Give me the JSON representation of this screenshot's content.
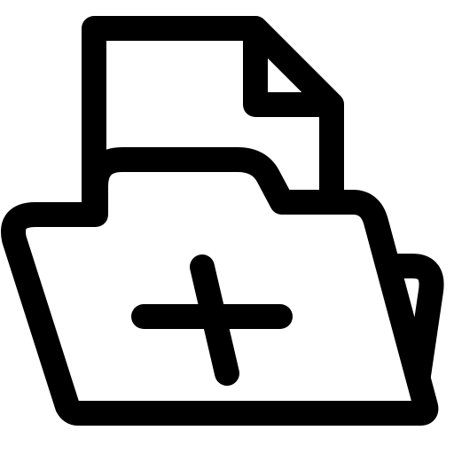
{
  "icon": {
    "name": "add-file-to-folder-icon",
    "stroke_color": "#000000",
    "fill_color": "#ffffff",
    "background_color": "#ffffff"
  }
}
